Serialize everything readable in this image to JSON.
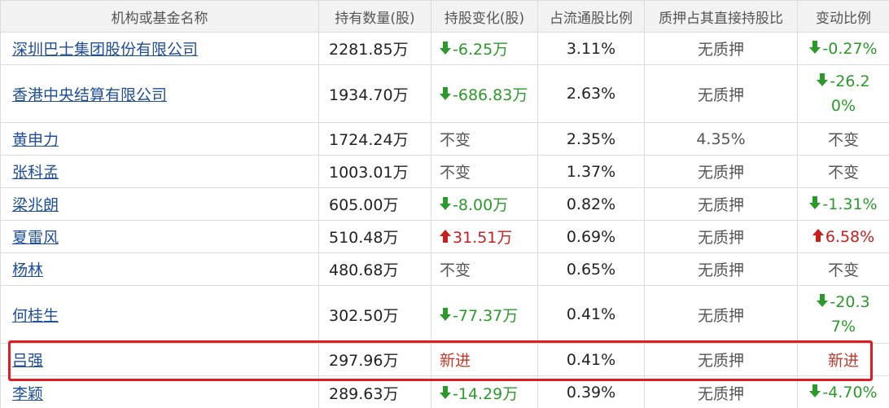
{
  "columns": [
    "机构或基金名称",
    "持有数量(股)",
    "持股变化(股)",
    "占流通股比例",
    "质押占其直接持股比",
    "变动比例"
  ],
  "rows": [
    {
      "name": "深圳巴士集团股份有限公司",
      "holding": "2281.85万",
      "change": "-6.25万",
      "change_dir": "down",
      "float_pct": "3.11%",
      "pledge": "无质押",
      "ratio": "-0.27%",
      "ratio_dir": "down"
    },
    {
      "name": "香港中央结算有限公司",
      "holding": "1934.70万",
      "change": "-686.83万",
      "change_dir": "down",
      "float_pct": "2.63%",
      "pledge": "无质押",
      "ratio": "-26.20%",
      "ratio_dir": "down"
    },
    {
      "name": "黄申力",
      "holding": "1724.24万",
      "change": "不变",
      "change_dir": "none",
      "float_pct": "2.35%",
      "pledge": "4.35%",
      "ratio": "不变",
      "ratio_dir": "none"
    },
    {
      "name": "张科孟",
      "holding": "1003.01万",
      "change": "不变",
      "change_dir": "none",
      "float_pct": "1.37%",
      "pledge": "无质押",
      "ratio": "不变",
      "ratio_dir": "none"
    },
    {
      "name": "梁兆朗",
      "holding": "605.00万",
      "change": "-8.00万",
      "change_dir": "down",
      "float_pct": "0.82%",
      "pledge": "无质押",
      "ratio": "-1.31%",
      "ratio_dir": "down"
    },
    {
      "name": "夏雷风",
      "holding": "510.48万",
      "change": "31.51万",
      "change_dir": "up",
      "float_pct": "0.69%",
      "pledge": "无质押",
      "ratio": "6.58%",
      "ratio_dir": "up"
    },
    {
      "name": "杨林",
      "holding": "480.68万",
      "change": "不变",
      "change_dir": "none",
      "float_pct": "0.65%",
      "pledge": "无质押",
      "ratio": "不变",
      "ratio_dir": "none"
    },
    {
      "name": "何桂生",
      "holding": "302.50万",
      "change": "-77.37万",
      "change_dir": "down",
      "float_pct": "0.41%",
      "pledge": "无质押",
      "ratio": "-20.37%",
      "ratio_dir": "down"
    },
    {
      "name": "吕强",
      "holding": "297.96万",
      "change": "新进",
      "change_dir": "new",
      "float_pct": "0.41%",
      "pledge": "无质押",
      "ratio": "新进",
      "ratio_dir": "new"
    },
    {
      "name": "李颖",
      "holding": "289.63万",
      "change": "-14.29万",
      "change_dir": "down",
      "float_pct": "0.39%",
      "pledge": "无质押",
      "ratio": "-4.70%",
      "ratio_dir": "down"
    }
  ],
  "highlighted_row": 8,
  "colors": {
    "down": "#2b9a2b",
    "up": "#c81e1e",
    "new": "#c0392b",
    "link": "#1f4e9a",
    "highlight": "#e01b24"
  },
  "icons": {
    "down": "arrow-down-icon",
    "up": "arrow-up-icon"
  }
}
